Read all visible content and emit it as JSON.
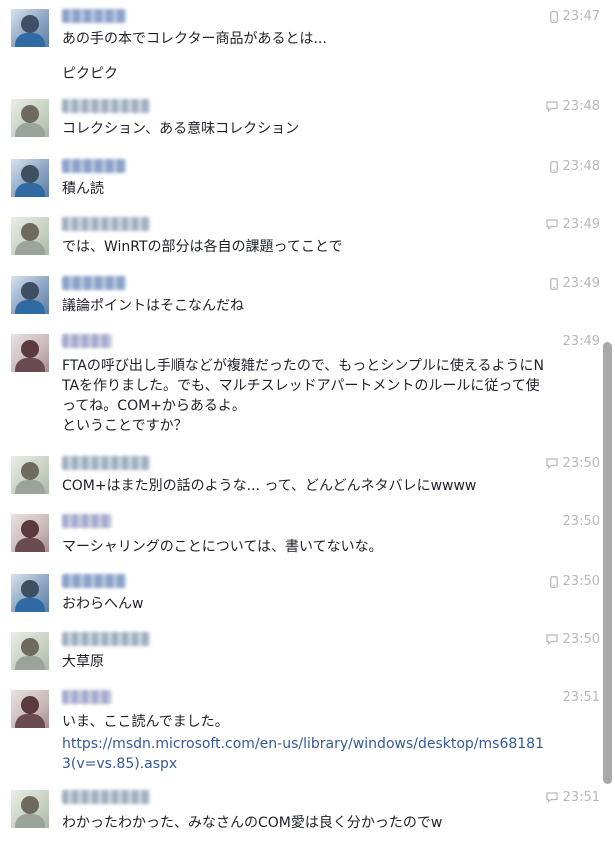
{
  "messages": [
    {
      "avatar": "blue",
      "name_style": "blue",
      "time": "23:47",
      "device": "mobile-icon",
      "lines": [
        "あの手の本でコレクター商品があるとは..."
      ]
    },
    {
      "continuation": "ピクピク"
    },
    {
      "avatar": "green",
      "name_style": "gray",
      "time": "23:48",
      "device": "chat-icon",
      "lines": [
        "コレクション、ある意味コレクション"
      ]
    },
    {
      "avatar": "blue",
      "name_style": "blue",
      "time": "23:48",
      "device": "mobile-icon",
      "lines": [
        "積ん読"
      ]
    },
    {
      "avatar": "green",
      "name_style": "gray",
      "time": "23:49",
      "device": "chat-icon",
      "lines": [
        "では、WinRTの部分は各自の課題ってことで"
      ]
    },
    {
      "avatar": "blue",
      "name_style": "blue",
      "time": "23:49",
      "device": "mobile-icon",
      "lines": [
        "議論ポイントはそこなんだね"
      ]
    },
    {
      "avatar": "red",
      "name_style": "red",
      "time": "23:49",
      "device": "",
      "lines": [
        "FTAの呼び出し手順などが複雑だったので、もっとシンプルに使えるようにNTAを作りました。でも、マルチスレッドアパートメントのルールに従って使ってね。COM+からあるよ。",
        "ということですか？"
      ]
    },
    {
      "avatar": "green",
      "name_style": "gray",
      "time": "23:50",
      "device": "chat-icon",
      "lines": [
        "COM+はまた別の話のような... って、どんどんネタバレにwwww"
      ]
    },
    {
      "avatar": "red",
      "name_style": "red",
      "time": "23:50",
      "device": "",
      "lines": [
        "マーシャリングのことについては、書いてないな。"
      ]
    },
    {
      "avatar": "blue",
      "name_style": "blue",
      "time": "23:50",
      "device": "mobile-icon",
      "lines": [
        "おわらへんw"
      ]
    },
    {
      "avatar": "green",
      "name_style": "gray",
      "time": "23:50",
      "device": "chat-icon",
      "lines": [
        "大草原"
      ]
    },
    {
      "avatar": "red",
      "name_style": "red",
      "time": "23:51",
      "device": "",
      "lines": [
        "いま、ここ読んでました。"
      ],
      "link": "https://msdn.microsoft.com/en-us/library/windows/desktop/ms681813(v=vs.85).aspx"
    },
    {
      "avatar": "green",
      "name_style": "gray",
      "time": "23:51",
      "device": "chat-icon",
      "lines": [
        "わかったわかった、みなさんのCOM愛は良く分かったのでw"
      ]
    }
  ],
  "colors": {
    "link": "#365899",
    "timestamp": "#b4b8bf",
    "text": "#1d2129",
    "scrollbar": "#a9a9a9"
  }
}
